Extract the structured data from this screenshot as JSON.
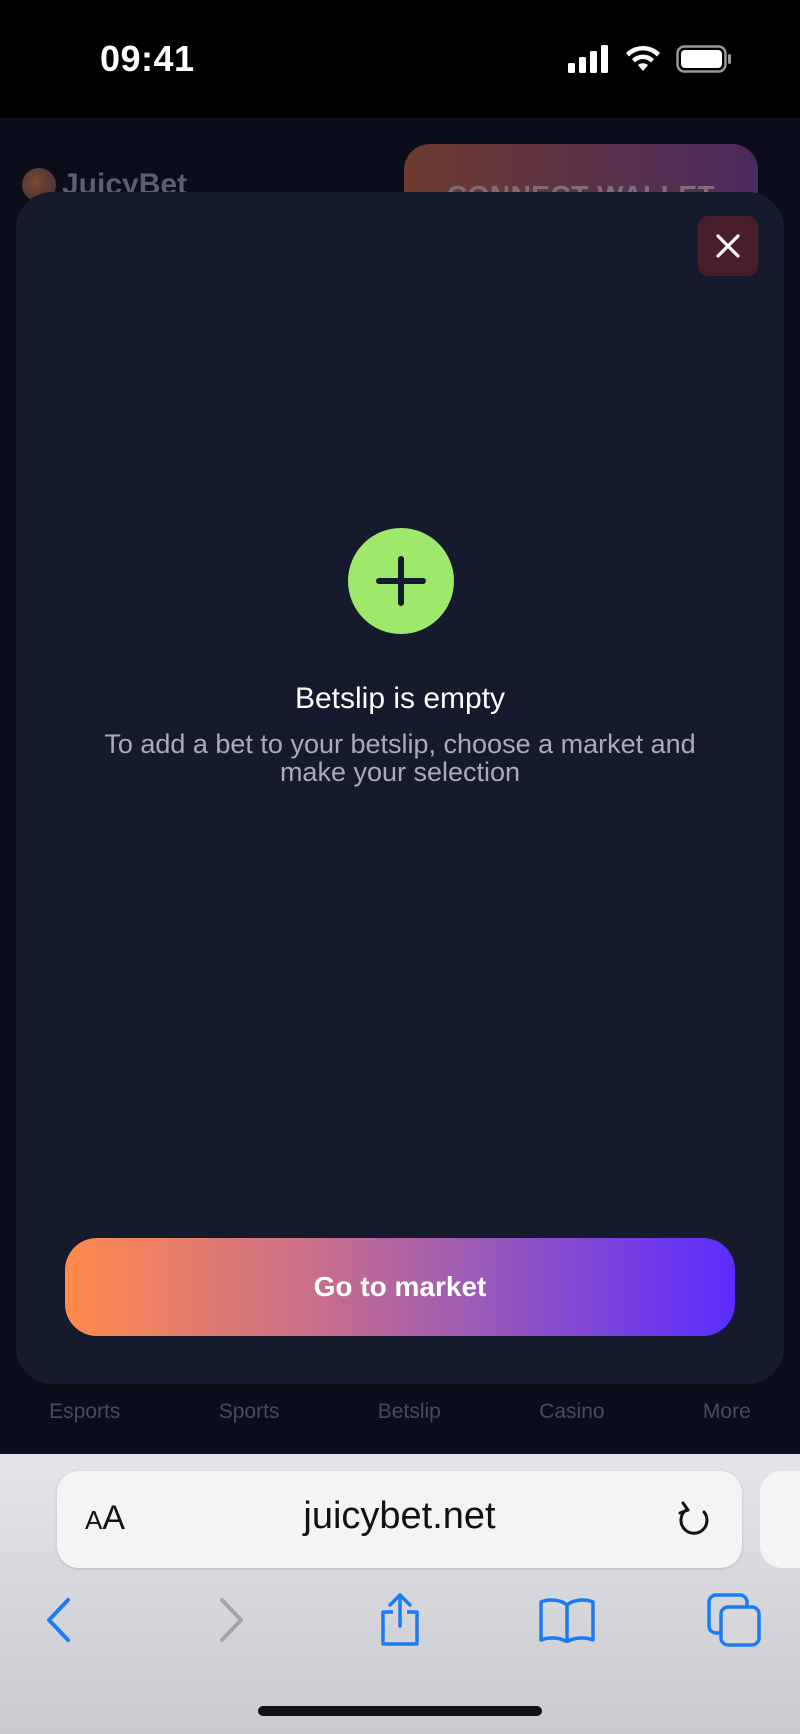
{
  "status_bar": {
    "time": "09:41"
  },
  "app": {
    "logo_text": "JuicyBet",
    "connect_wallet_label": "CONNECT WALLET",
    "bottom_nav": [
      {
        "label": "Esports"
      },
      {
        "label": "Sports"
      },
      {
        "label": "Betslip"
      },
      {
        "label": "Casino"
      },
      {
        "label": "More"
      }
    ]
  },
  "betslip": {
    "title": "Betslip is empty",
    "description": "To add a bet to your betslip, choose a market and make your selection",
    "cta_label": "Go to market",
    "close_icon": "close-icon",
    "accent_green": "#9ee86b",
    "close_bg": "#4a1d2b",
    "gradient_start": "#ff8a4c",
    "gradient_end": "#5b2cff"
  },
  "browser": {
    "aa_label_small": "A",
    "aa_label_large": "A",
    "url": "juicybet.net",
    "accent": "#1a7cf5"
  }
}
